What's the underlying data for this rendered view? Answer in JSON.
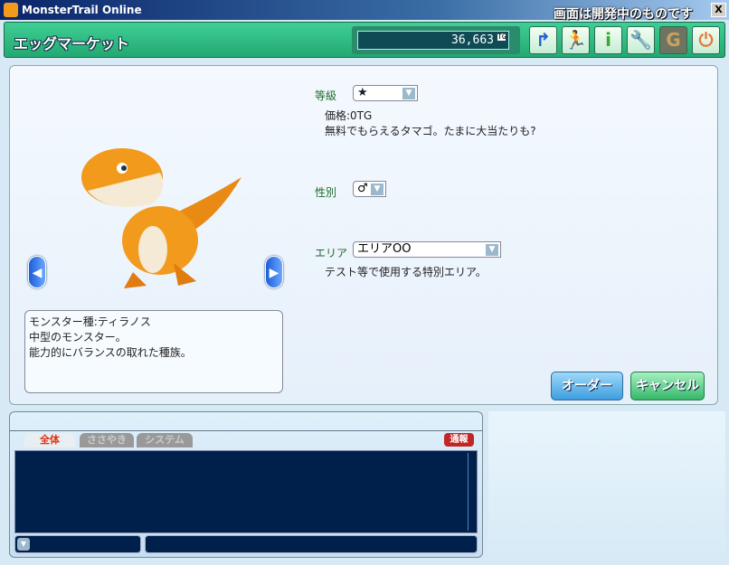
{
  "window": {
    "title": "MonsterTrail Online",
    "dev_note": "画面は開発中のものです",
    "close": "X"
  },
  "header": {
    "title": "エッグマーケット",
    "money": "36,663",
    "money_unit": "TG",
    "toolbar": [
      {
        "name": "return-icon",
        "glyph": "↱"
      },
      {
        "name": "run-icon",
        "glyph": "🏃"
      },
      {
        "name": "info-icon",
        "glyph": "i"
      },
      {
        "name": "wrench-icon",
        "glyph": "🔧"
      },
      {
        "name": "money-bag-icon",
        "glyph": "G"
      },
      {
        "name": "power-icon",
        "glyph": "⏻"
      }
    ]
  },
  "form": {
    "grade_label": "等級",
    "grade_value": "★",
    "price": "価格:0TG",
    "egg_desc": "無料でもらえるタマゴ。たまに大当たりも?",
    "gender_label": "性別",
    "gender_value": "♂",
    "area_label": "エリア",
    "area_value": "エリアOO",
    "area_desc": "テスト等で使用する特別エリア。"
  },
  "monster": {
    "desc_lines": [
      "モンスター種:ティラノス",
      "中型のモンスター。",
      "能力的にバランスの取れた種族。"
    ],
    "prev": "◀",
    "next": "▶"
  },
  "buttons": {
    "order": "オーダー",
    "cancel": "キャンセル"
  },
  "chat": {
    "tabs": [
      "全体",
      "ささやき",
      "システム"
    ],
    "report": "通報"
  }
}
